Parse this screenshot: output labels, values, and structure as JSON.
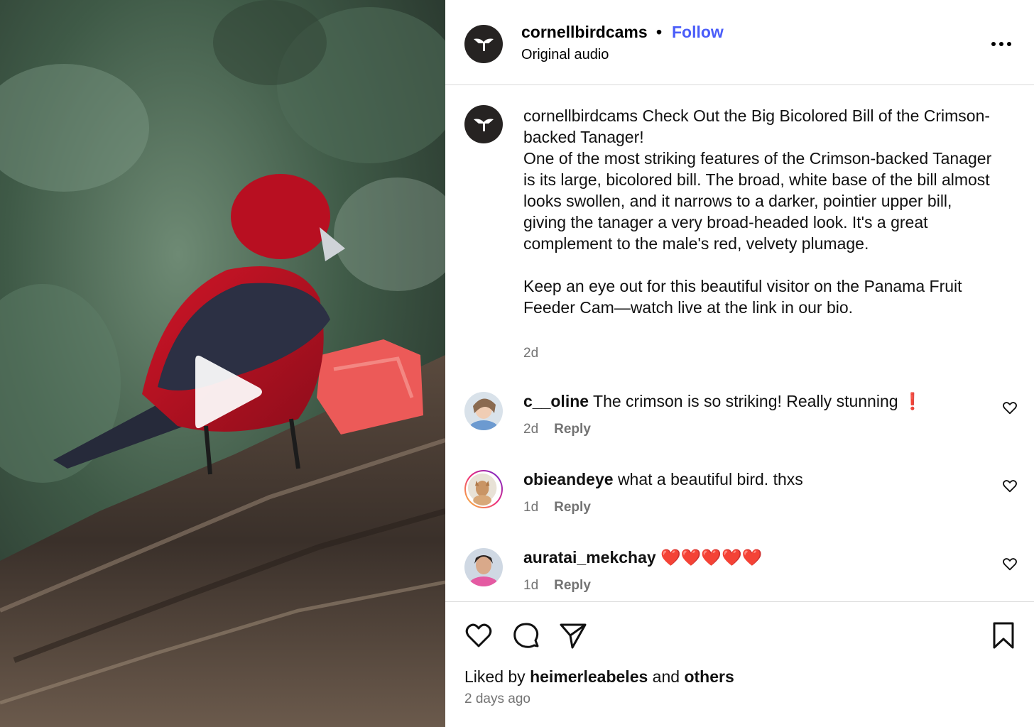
{
  "post": {
    "username": "cornellbirdcams",
    "separator": "•",
    "follow_label": "Follow",
    "audio_label": "Original audio"
  },
  "caption": {
    "username": "cornellbirdcams",
    "headline": "Check Out the Big Bicolored Bill of the Crimson-backed Tanager!",
    "body": "One of the most striking features of the Crimson-backed Tanager is its large, bicolored bill. The broad, white base of the bill almost looks swollen, and it narrows to a darker, pointier upper bill, giving the tanager a very broad-headed look. It's a great complement to the male's red, velvety plumage.",
    "body2": "Keep an eye out for this beautiful visitor on the Panama Fruit Feeder Cam—watch live at the link in our bio.",
    "time": "2d"
  },
  "comments": [
    {
      "username": "c__oline",
      "text": "The crimson is so striking! Really stunning ❗",
      "time": "2d",
      "reply_label": "Reply"
    },
    {
      "username": "obieandeye",
      "text": "what a beautiful bird. thxs",
      "time": "1d",
      "reply_label": "Reply"
    },
    {
      "username": "auratai_mekchay",
      "text": "❤️❤️❤️❤️❤️",
      "time": "1d",
      "reply_label": "Reply"
    }
  ],
  "likes": {
    "prefix": "Liked by",
    "user": "heimerleabeles",
    "and": "and",
    "others": "others"
  },
  "posted_ago": "2 days ago",
  "icons": {
    "more": "more-horizontal-icon",
    "like": "heart-icon",
    "comment": "comment-icon",
    "share": "send-icon",
    "save": "bookmark-icon",
    "play": "play-icon"
  },
  "colors": {
    "follow": "#4a5df9",
    "meta": "#737373",
    "brand_avatar": "#262322"
  }
}
